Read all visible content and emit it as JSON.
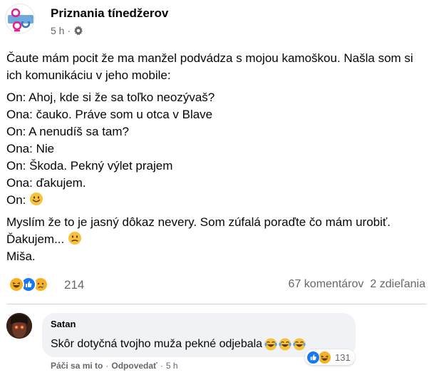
{
  "post": {
    "page_name": "Priznania tínedžerov",
    "time": "5 h",
    "separator": "·",
    "intro": "Čaute mám pocit že ma manžel podvádza s mojou kamoškou. Našla som si ich komunikáciu v jeho mobile:",
    "conversation": [
      "On: Ahoj, kde si že sa toľko neozývaš?",
      "Ona: čauko. Práve som u otca v Blave",
      "On: A nenudíš sa tam?",
      "Ona: Nie",
      "On: Škoda. Pekný výlet prajem",
      "Ona: ďakujem.",
      "On:"
    ],
    "outro_text": "Myslím že to je jasný dôkaz nevery. Som zúfalá poraďte čo mám urobiť. Ďakujem...",
    "signature": "Miša."
  },
  "stats": {
    "reactions_count": "214",
    "comments": "67 komentárov",
    "shares": "2 zdieľania",
    "reaction_icons": [
      "haha-icon",
      "like-icon",
      "sad-icon"
    ]
  },
  "comment": {
    "author": "Satan",
    "text": "Skôr dotyčná tvojho muža pekné odjebala",
    "reactions_count": "131",
    "like_label": "Páči sa mi to",
    "reply_label": "Odpovedať",
    "time": "5 h",
    "separator": "·"
  },
  "colors": {
    "like_blue": "#1877f2",
    "react_yellow": "#f7b125",
    "secondary_text": "#65676b",
    "bubble_bg": "#f0f2f5"
  }
}
